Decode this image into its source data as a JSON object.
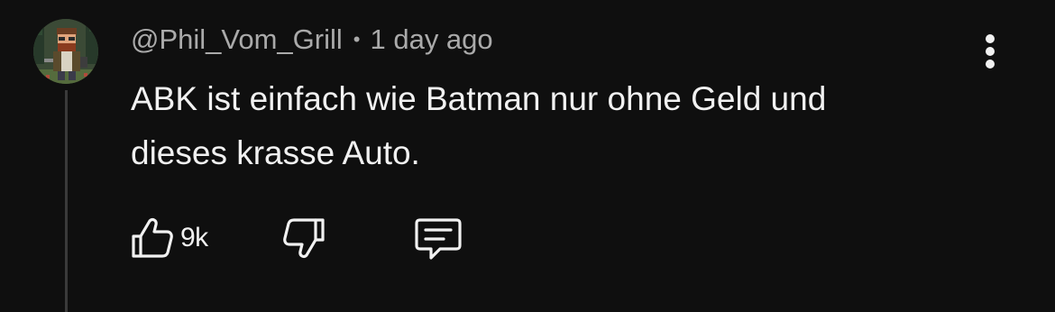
{
  "comment": {
    "author": "@Phil_Vom_Grill",
    "separator": "•",
    "time": "1 day ago",
    "text_lines": [
      "ABK ist einfach wie Batman nur ohne Geld und",
      "dieses krasse Auto."
    ],
    "like_count": "9k"
  },
  "icons": {
    "avatar": "pixel-art-avatar",
    "more": "vertical-dots-icon",
    "like": "thumbs-up-icon",
    "dislike": "thumbs-down-icon",
    "reply": "comment-bubble-icon"
  },
  "colors": {
    "background": "#0f0f0f",
    "text_primary": "#f1f1f1",
    "text_secondary": "#aaaaaa",
    "thread_line": "#3a3a3a"
  }
}
